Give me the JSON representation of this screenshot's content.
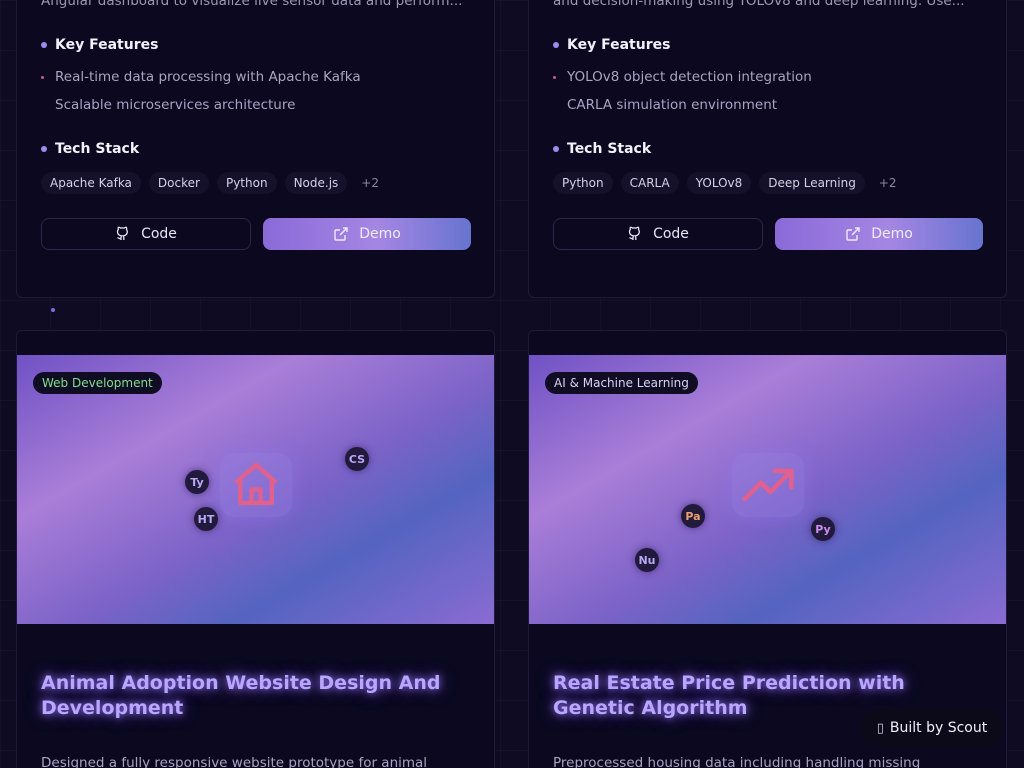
{
  "projects_top": [
    {
      "description": "Angular dashboard to visualize live sensor data and perform...",
      "features_heading": "Key Features",
      "features": [
        "Real-time data processing with Apache Kafka",
        "Scalable microservices architecture"
      ],
      "tech_heading": "Tech Stack",
      "tags": [
        "Apache Kafka",
        "Docker",
        "Python",
        "Node.js"
      ],
      "more_tags": "+2",
      "code_label": "Code",
      "demo_label": "Demo"
    },
    {
      "description": "and decision-making using YOLOv8 and deep learning. Use...",
      "features_heading": "Key Features",
      "features": [
        "YOLOv8 object detection integration",
        "CARLA simulation environment"
      ],
      "tech_heading": "Tech Stack",
      "tags": [
        "Python",
        "CARLA",
        "YOLOv8",
        "Deep Learning"
      ],
      "more_tags": "+2",
      "code_label": "Code",
      "demo_label": "Demo"
    }
  ],
  "projects_bottom": [
    {
      "category": "Web Development",
      "category_color": "#7fe08a",
      "hero_icon": "home-icon",
      "chips": [
        "Ty",
        "HT",
        "CS"
      ],
      "title": "Animal Adoption Website Design And Development",
      "description": "Designed a fully responsive website prototype for animal"
    },
    {
      "category": "AI & Machine Learning",
      "category_color": "#d9d4f4",
      "hero_icon": "trending-up-icon",
      "chips": [
        "Pa",
        "Nu",
        "Py"
      ],
      "title": "Real Estate Price Prediction with Genetic Algorithm",
      "description": "Preprocessed housing data including handling missing"
    }
  ],
  "built_badge": {
    "icon": "box-glyph",
    "label": "Built by Scout"
  },
  "colors": {
    "accent": "#9b8cf0",
    "title_glow": "#b8a6ff",
    "bullet": "#c4569a"
  }
}
